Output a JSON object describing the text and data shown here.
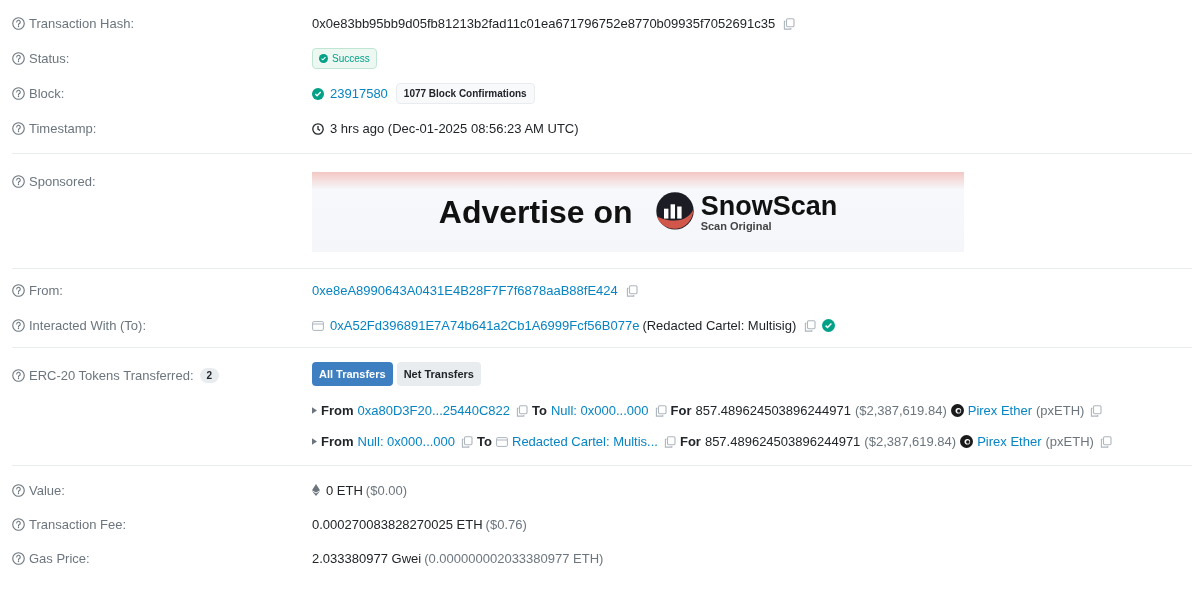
{
  "sections": [
    {
      "rows": [
        {
          "kind": "hash",
          "label": "Transaction Hash:",
          "value": "0x0e83bb95bb9d05fb81213b2fad11c01ea671796752e8770b09935f7052691c35"
        },
        {
          "kind": "status",
          "label": "Status:",
          "status": "Success"
        },
        {
          "kind": "block",
          "label": "Block:",
          "block": "23917580",
          "confirmations": "1077 Block Confirmations"
        },
        {
          "kind": "timestamp",
          "label": "Timestamp:",
          "value": "3 hrs ago (Dec-01-2025 08:56:23 AM UTC)"
        }
      ]
    },
    {
      "rows": [
        {
          "kind": "ad",
          "label": "Sponsored:",
          "headline": "Advertise on",
          "brand": "SnowScan",
          "tagline": "Scan Original"
        }
      ]
    },
    {
      "rows": [
        {
          "kind": "address",
          "label": "From:",
          "address": "0xe8eA8990643A0431E4B28F7F7f6878aaB88fE424"
        },
        {
          "kind": "contract",
          "label": "Interacted With (To):",
          "address": "0xA52Fd396891E7A74b641a2Cb1A6999Fcf56B077e",
          "name": "(Redacted Cartel: Multisig)",
          "verified": true
        }
      ]
    },
    {
      "rows": [
        {
          "kind": "tokens",
          "label": "ERC-20 Tokens Transferred:",
          "count": "2",
          "tabs": [
            {
              "label": "All Transfers",
              "selected": true
            },
            {
              "label": "Net Transfers",
              "selected": false
            }
          ],
          "transfers": [
            {
              "from_label": "From",
              "from": "0xa80D3F20...25440C822",
              "to_label": "To",
              "to": "Null: 0x000...000",
              "to_contract": false,
              "for_label": "For",
              "amount": "857.489624503896244971",
              "usd": "($2,387,619.84)",
              "token": "Pirex Ether",
              "symbol": "(pxETH)"
            },
            {
              "from_label": "From",
              "from": "Null: 0x000...000",
              "to_label": "To",
              "to": "Redacted Cartel: Multis...",
              "to_contract": true,
              "for_label": "For",
              "amount": "857.489624503896244971",
              "usd": "($2,387,619.84)",
              "token": "Pirex Ether",
              "symbol": "(pxETH)"
            }
          ]
        }
      ]
    },
    {
      "rows": [
        {
          "kind": "value",
          "label": "Value:",
          "value": "0 ETH",
          "secondary": "($0.00)"
        },
        {
          "kind": "amount",
          "label": "Transaction Fee:",
          "value": "0.000270083828270025 ETH",
          "secondary": "($0.76)"
        },
        {
          "kind": "amount",
          "label": "Gas Price:",
          "value": "2.033380977 Gwei",
          "secondary": "(0.000000002033380977 ETH)"
        }
      ]
    }
  ]
}
